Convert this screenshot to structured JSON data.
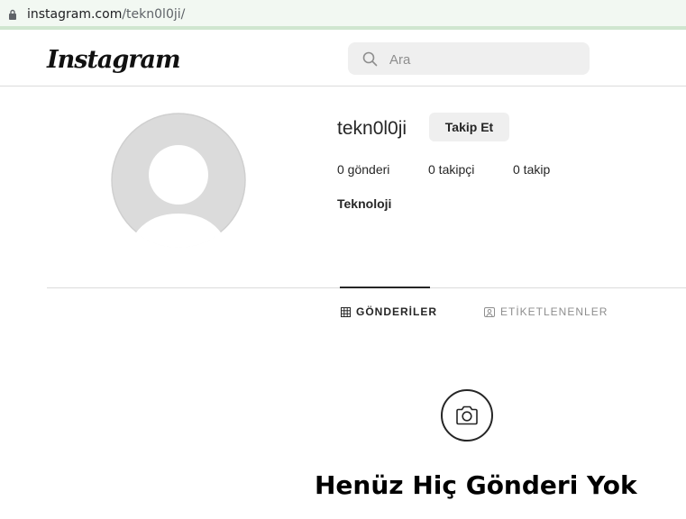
{
  "browser": {
    "url_domain": "instagram.com",
    "url_path": "/tekn0l0ji/",
    "lock_icon": "lock-icon"
  },
  "header": {
    "logo_text": "Instagram",
    "search": {
      "placeholder": "Ara",
      "icon": "search-icon"
    }
  },
  "profile": {
    "username": "tekn0l0ji",
    "follow_label": "Takip Et",
    "stats": {
      "posts": "0 gönderi",
      "followers": "0 takipçi",
      "following": "0 takip"
    },
    "full_name": "Teknoloji",
    "avatar": "default-avatar"
  },
  "tabs": [
    {
      "label": "GÖNDERİLER",
      "icon": "grid-icon",
      "active": true
    },
    {
      "label": "ETİKETLENENLER",
      "icon": "tag-icon",
      "active": false
    }
  ],
  "empty_state": {
    "icon": "camera-icon",
    "title": "Henüz Hiç Gönderi Yok"
  }
}
